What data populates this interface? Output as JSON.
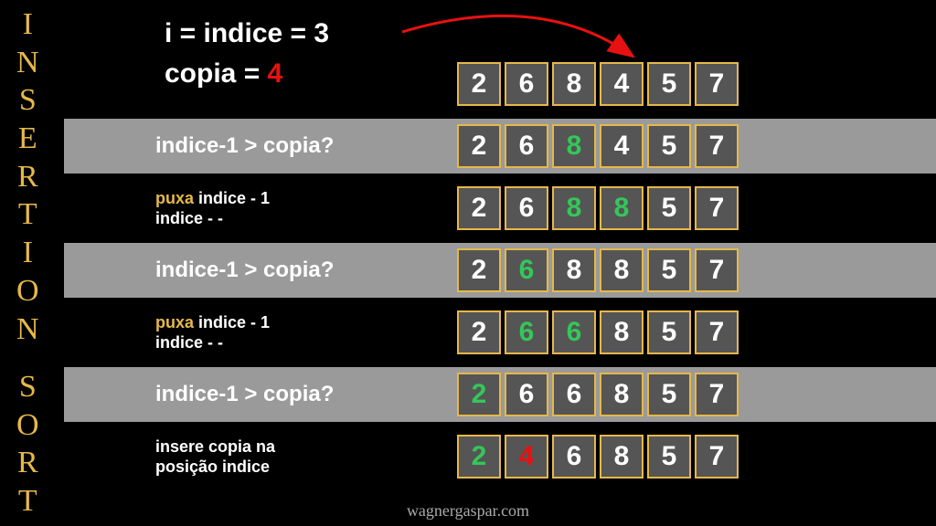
{
  "title_letters": [
    "I",
    "N",
    "S",
    "E",
    "R",
    "T",
    "I",
    "O",
    "N",
    "",
    "S",
    "O",
    "R",
    "T"
  ],
  "header": {
    "line1": "i = indice = 3",
    "line2_prefix": "copia = ",
    "line2_value": "4"
  },
  "rows": [
    {
      "label_html": "indice-1 > copia?",
      "gray": true,
      "cells": [
        {
          "v": "2"
        },
        {
          "v": "6"
        },
        {
          "v": "8",
          "cls": "green"
        },
        {
          "v": "4"
        },
        {
          "v": "5"
        },
        {
          "v": "7"
        }
      ]
    },
    {
      "label_lines": [
        {
          "parts": [
            {
              "t": "puxa",
              "cls": "yellow"
            },
            {
              "t": " indice - 1"
            }
          ]
        },
        {
          "parts": [
            {
              "t": "indice - -"
            }
          ]
        }
      ],
      "gray": false,
      "cells": [
        {
          "v": "2"
        },
        {
          "v": "6"
        },
        {
          "v": "8",
          "cls": "green"
        },
        {
          "v": "8",
          "cls": "green"
        },
        {
          "v": "5"
        },
        {
          "v": "7"
        }
      ]
    },
    {
      "label_html": "indice-1 > copia?",
      "gray": true,
      "cells": [
        {
          "v": "2"
        },
        {
          "v": "6",
          "cls": "green"
        },
        {
          "v": "8"
        },
        {
          "v": "8"
        },
        {
          "v": "5"
        },
        {
          "v": "7"
        }
      ]
    },
    {
      "label_lines": [
        {
          "parts": [
            {
              "t": "puxa",
              "cls": "yellow"
            },
            {
              "t": " indice - 1"
            }
          ]
        },
        {
          "parts": [
            {
              "t": "indice - -"
            }
          ]
        }
      ],
      "gray": false,
      "cells": [
        {
          "v": "2"
        },
        {
          "v": "6",
          "cls": "green"
        },
        {
          "v": "6",
          "cls": "green"
        },
        {
          "v": "8"
        },
        {
          "v": "5"
        },
        {
          "v": "7"
        }
      ]
    },
    {
      "label_html": "indice-1 > copia?",
      "gray": true,
      "cells": [
        {
          "v": "2",
          "cls": "green"
        },
        {
          "v": "6"
        },
        {
          "v": "6"
        },
        {
          "v": "8"
        },
        {
          "v": "5"
        },
        {
          "v": "7"
        }
      ]
    },
    {
      "label_lines": [
        {
          "parts": [
            {
              "t": "insere copia na"
            }
          ]
        },
        {
          "parts": [
            {
              "t": "posição indice"
            }
          ]
        }
      ],
      "gray": false,
      "cells": [
        {
          "v": "2",
          "cls": "green"
        },
        {
          "v": "4",
          "cls": "red"
        },
        {
          "v": "6"
        },
        {
          "v": "8"
        },
        {
          "v": "5"
        },
        {
          "v": "7"
        }
      ]
    }
  ],
  "header_array": [
    {
      "v": "2"
    },
    {
      "v": "6"
    },
    {
      "v": "8"
    },
    {
      "v": "4"
    },
    {
      "v": "5"
    },
    {
      "v": "7"
    }
  ],
  "footer": "wagnergaspar.com",
  "colors": {
    "accent": "#e6b84a",
    "green": "#34c759",
    "red": "#e81111",
    "gray": "#9a9a9a",
    "cell": "#555555"
  }
}
